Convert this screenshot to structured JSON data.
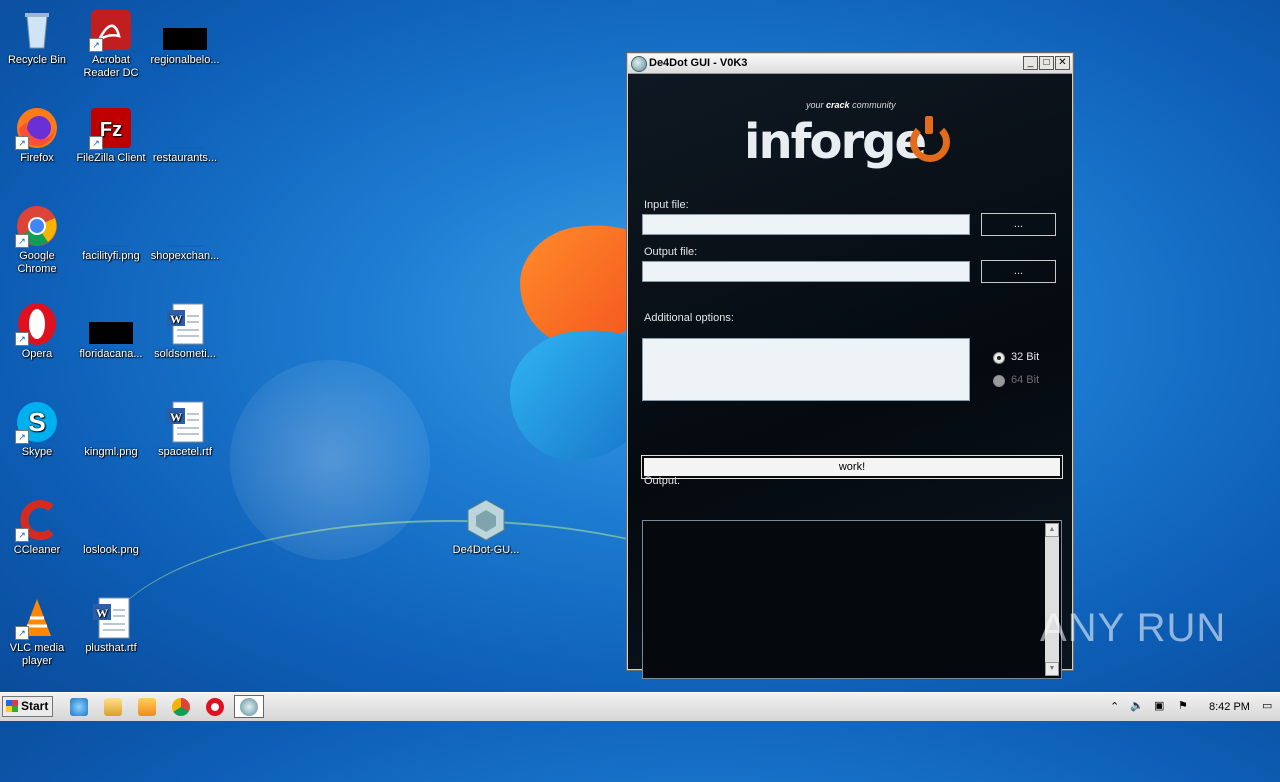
{
  "desktop": {
    "icons": [
      {
        "label": "Recycle Bin"
      },
      {
        "label": "Acrobat Reader DC"
      },
      {
        "label": "regionalbelo..."
      },
      {
        "label": "Firefox"
      },
      {
        "label": "FileZilla Client"
      },
      {
        "label": "restaurants..."
      },
      {
        "label": "Google Chrome"
      },
      {
        "label": "facilityfi.png"
      },
      {
        "label": "shopexchan..."
      },
      {
        "label": "Opera"
      },
      {
        "label": "floridacana..."
      },
      {
        "label": "soldsometi..."
      },
      {
        "label": "Skype"
      },
      {
        "label": "kingml.png"
      },
      {
        "label": "spacetel.rtf"
      },
      {
        "label": "CCleaner"
      },
      {
        "label": "loslook.png"
      },
      {
        "label": "De4Dot-GU..."
      },
      {
        "label": "VLC media player"
      },
      {
        "label": "plusthat.rtf"
      }
    ]
  },
  "window": {
    "title": "De4Dot GUI - V0K3",
    "logo_word": "inforge",
    "logo_tag_prefix": "your",
    "logo_tag_bold": "crack",
    "logo_tag_suffix": "community",
    "input_label": "Input file:",
    "input_value": "",
    "input_browse": "...",
    "output_file_label": "Output file:",
    "output_file_value": "",
    "output_browse": "...",
    "options_label": "Additional options:",
    "options_value": "",
    "radio_32": "32 Bit",
    "radio_64": "64 Bit",
    "work_button": "work!",
    "output_label": "Output:",
    "output_text": ""
  },
  "taskbar": {
    "start": "Start",
    "time": "8:42 PM"
  },
  "watermark": "ANY RUN"
}
